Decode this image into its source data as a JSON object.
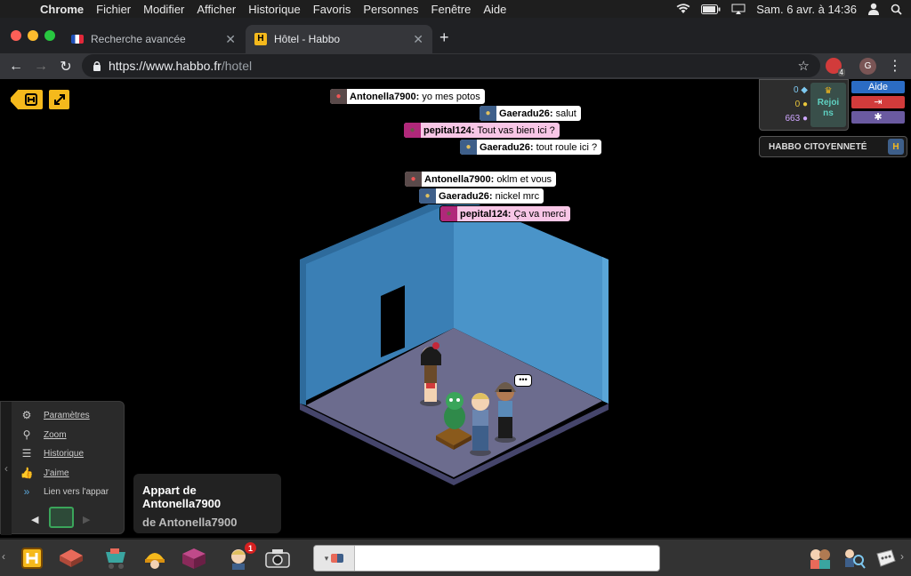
{
  "menubar": {
    "app": "Chrome",
    "items": [
      "Fichier",
      "Modifier",
      "Afficher",
      "Historique",
      "Favoris",
      "Personnes",
      "Fenêtre",
      "Aide"
    ],
    "clock": "Sam. 6 avr. à 14:36"
  },
  "browser": {
    "tabs": [
      {
        "title": "Recherche avancée"
      },
      {
        "title": "Hôtel - Habbo"
      }
    ],
    "url_host": "https://www.habbo.fr",
    "url_path": "/hotel",
    "extension_badge": "4",
    "profile_initial": "G"
  },
  "chat": [
    {
      "name": "Antonella7900:",
      "text": "yo mes potos",
      "style": "dark"
    },
    {
      "name": "Gaeradu26:",
      "text": "salut",
      "style": "blue"
    },
    {
      "name": "pepital124:",
      "text": "Tout vas bien ici ?",
      "style": "pink"
    },
    {
      "name": "Gaeradu26:",
      "text": "tout roule ici ?",
      "style": "blue"
    },
    {
      "name": "Antonella7900:",
      "text": "oklm et vous",
      "style": "dark"
    },
    {
      "name": "Gaeradu26:",
      "text": "nickel mrc",
      "style": "blue"
    },
    {
      "name": "pepital124:",
      "text": "Ça va merci",
      "style": "pink"
    }
  ],
  "purse": {
    "credits": "0",
    "duckets": "0",
    "diamonds": "663",
    "join_label": "Rejoi ns"
  },
  "side_buttons": {
    "help": "Aide",
    "logout": "⇥",
    "settings": "✱"
  },
  "citizenship": {
    "label": "HABBO CITOYENNETÉ",
    "icon": "H"
  },
  "room_tools": {
    "settings": "Paramètres",
    "zoom": "Zoom",
    "history": "Historique",
    "like": "J'aime",
    "link": "Lien vers l'appar"
  },
  "room_info": {
    "name": "Appart de Antonella7900",
    "owner": "de Antonella7900"
  },
  "bottombar": {
    "friends_badge": "1",
    "chat_placeholder": ""
  },
  "speech_bubble": "•••",
  "colors": {
    "habbo_yellow": "#f5b91c",
    "wall": "#3a7fb5",
    "floor": "#6c6c8e",
    "help_blue": "#2b6cc4",
    "logout_red": "#d23b3b",
    "settings_purple": "#6a5aa0"
  }
}
